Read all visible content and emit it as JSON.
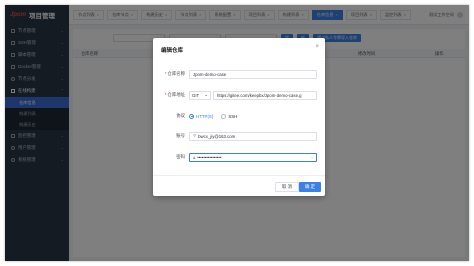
{
  "brand": {
    "logo": "Jpom",
    "title": "项目管理"
  },
  "sidebar": {
    "items": [
      {
        "label": "节点管理"
      },
      {
        "label": "SSH管理"
      },
      {
        "label": "脚本管理"
      },
      {
        "label": "Docker管理"
      },
      {
        "label": "节点分发"
      },
      {
        "label": "在线构建"
      }
    ],
    "sub_items": [
      {
        "label": "仓库信息"
      },
      {
        "label": "构建列表"
      },
      {
        "label": "构建历史"
      }
    ],
    "items_after": [
      {
        "label": "监控管理"
      },
      {
        "label": "用户管理"
      },
      {
        "label": "系统管理"
      }
    ]
  },
  "tabbar": {
    "tabs": [
      {
        "label": "节点列表"
      },
      {
        "label": "仓库节点"
      },
      {
        "label": "构建历史"
      },
      {
        "label": "节点列表"
      },
      {
        "label": "系统配置"
      },
      {
        "label": "项目列表"
      },
      {
        "label": "构建列表"
      },
      {
        "label": "仓库信息"
      },
      {
        "label": "项目列表"
      },
      {
        "label": "监控列表"
      }
    ],
    "user_label": "测试工作空间"
  },
  "table": {
    "col_name": "仓库名称",
    "col_time": "修改时间",
    "col_ops": "操作"
  },
  "toolbar": {
    "search_label": "搜",
    "add_label": "新",
    "import_label": "通过私人令牌导入仓库"
  },
  "dialog": {
    "title": "编辑仓库",
    "close_icon": "close-icon",
    "name_label": "仓库名称",
    "name_value": "Jpom-demo-case",
    "url_label": "仓库地址",
    "protocol_value": "GIT",
    "url_value": "https://gitee.com/keepbx/Jpom-demo-case.g",
    "protocol_label": "协议",
    "http_label": "HTTP(S)",
    "ssh_label": "SSH",
    "account_label": "账号",
    "account_value": "bwcx_jiy@163.com",
    "password_label": "密码",
    "password_value": "••••••••••••••••",
    "cancel_label": "取 消",
    "ok_label": "确 定"
  },
  "colors": {
    "accent": "#3a80ea",
    "sidebar_bg": "#2b3645",
    "required": "#e04040"
  }
}
